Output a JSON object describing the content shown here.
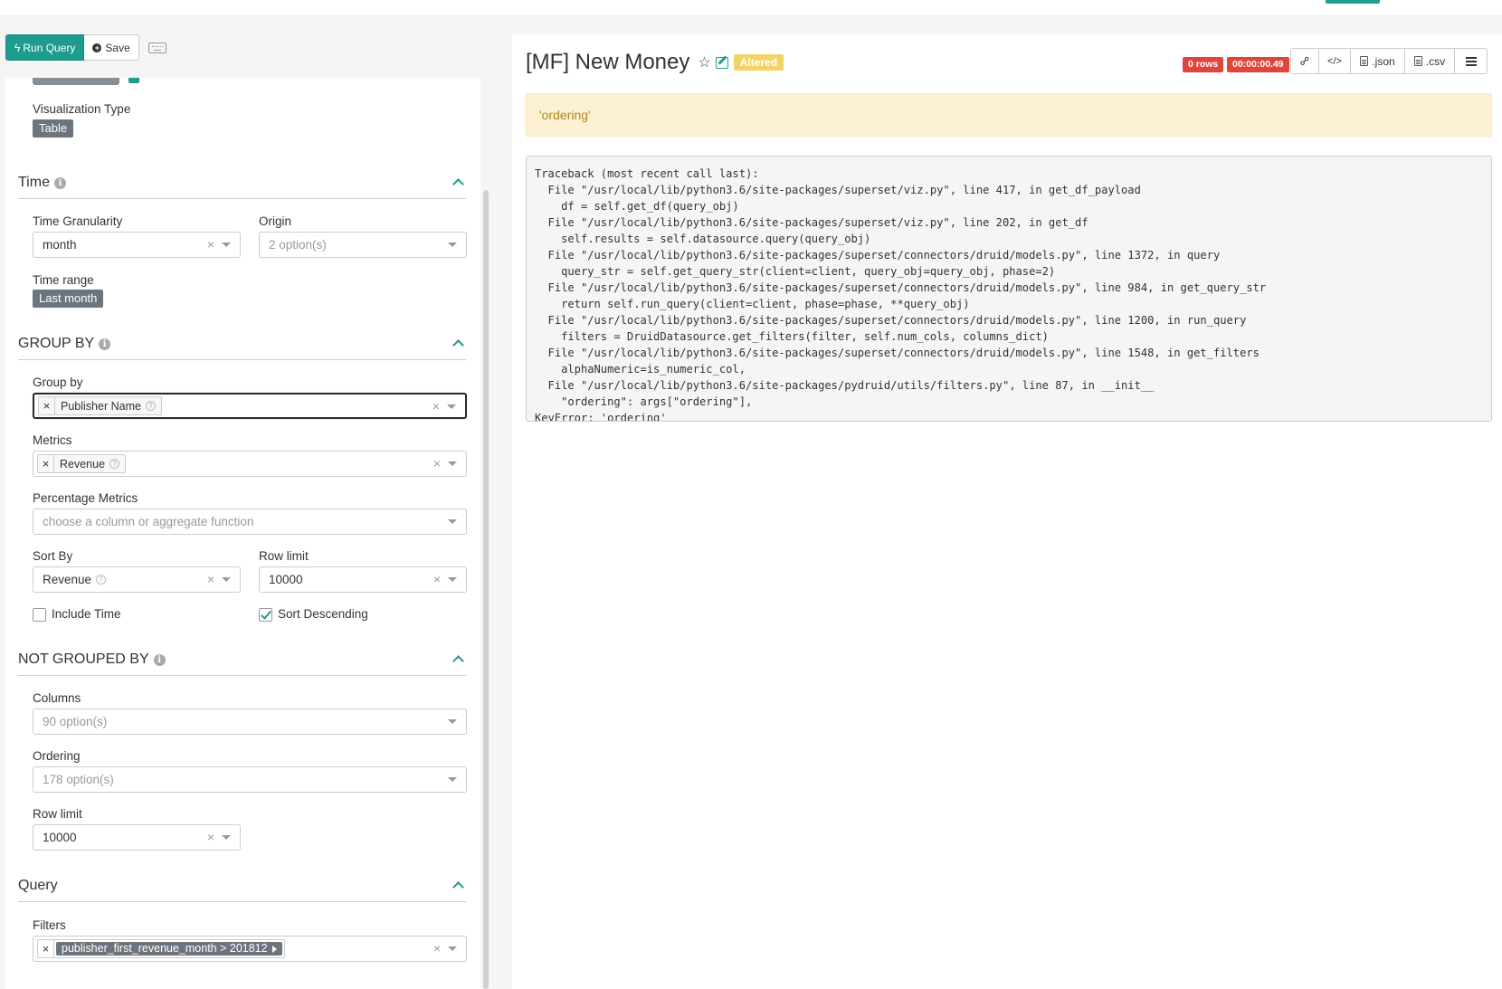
{
  "toolbar": {
    "run_label": "Run Query",
    "save_label": "Save"
  },
  "left": {
    "viz_type_label": "Visualization Type",
    "viz_type_value": "Table",
    "time": {
      "title": "Time",
      "granularity_label": "Time Granularity",
      "granularity_value": "month",
      "origin_label": "Origin",
      "origin_placeholder": "2 option(s)",
      "range_label": "Time range",
      "range_value": "Last month"
    },
    "group_by": {
      "title": "GROUP BY",
      "group_by_label": "Group by",
      "group_by_value": "Publisher Name",
      "metrics_label": "Metrics",
      "metrics_value": "Revenue",
      "pct_metrics_label": "Percentage Metrics",
      "pct_metrics_placeholder": "choose a column or aggregate function",
      "sort_by_label": "Sort By",
      "sort_by_value": "Revenue",
      "row_limit_label": "Row limit",
      "row_limit_value": "10000",
      "include_time_label": "Include Time",
      "include_time_checked": false,
      "sort_desc_label": "Sort Descending",
      "sort_desc_checked": true
    },
    "not_grouped_by": {
      "title": "NOT GROUPED BY",
      "columns_label": "Columns",
      "columns_placeholder": "90 option(s)",
      "ordering_label": "Ordering",
      "ordering_placeholder": "178 option(s)",
      "row_limit_label": "Row limit",
      "row_limit_value": "10000"
    },
    "query": {
      "title": "Query",
      "filters_label": "Filters",
      "filter_value": "publisher_first_revenue_month > 201812"
    }
  },
  "right": {
    "title": "[MF] New Money",
    "altered_label": "Altered",
    "rows_badge": "0 rows",
    "time_badge": "00:00:00.49",
    "json_label": ".json",
    "csv_label": ".csv",
    "alert_text": "'ordering'",
    "traceback": "Traceback (most recent call last):\n  File \"/usr/local/lib/python3.6/site-packages/superset/viz.py\", line 417, in get_df_payload\n    df = self.get_df(query_obj)\n  File \"/usr/local/lib/python3.6/site-packages/superset/viz.py\", line 202, in get_df\n    self.results = self.datasource.query(query_obj)\n  File \"/usr/local/lib/python3.6/site-packages/superset/connectors/druid/models.py\", line 1372, in query\n    query_str = self.get_query_str(client=client, query_obj=query_obj, phase=2)\n  File \"/usr/local/lib/python3.6/site-packages/superset/connectors/druid/models.py\", line 984, in get_query_str\n    return self.run_query(client=client, phase=phase, **query_obj)\n  File \"/usr/local/lib/python3.6/site-packages/superset/connectors/druid/models.py\", line 1200, in run_query\n    filters = DruidDatasource.get_filters(filter, self.num_cols, columns_dict)\n  File \"/usr/local/lib/python3.6/site-packages/superset/connectors/druid/models.py\", line 1548, in get_filters\n    alphaNumeric=is_numeric_col,\n  File \"/usr/local/lib/python3.6/site-packages/pydruid/utils/filters.py\", line 87, in __init__\n    \"ordering\": args[\"ordering\"],\nKeyError: 'ordering'"
  },
  "colors": {
    "accent": "#1e9c8d",
    "danger": "#e0453c",
    "warning_bg": "#fcf1d2",
    "altered": "#f3d365"
  }
}
